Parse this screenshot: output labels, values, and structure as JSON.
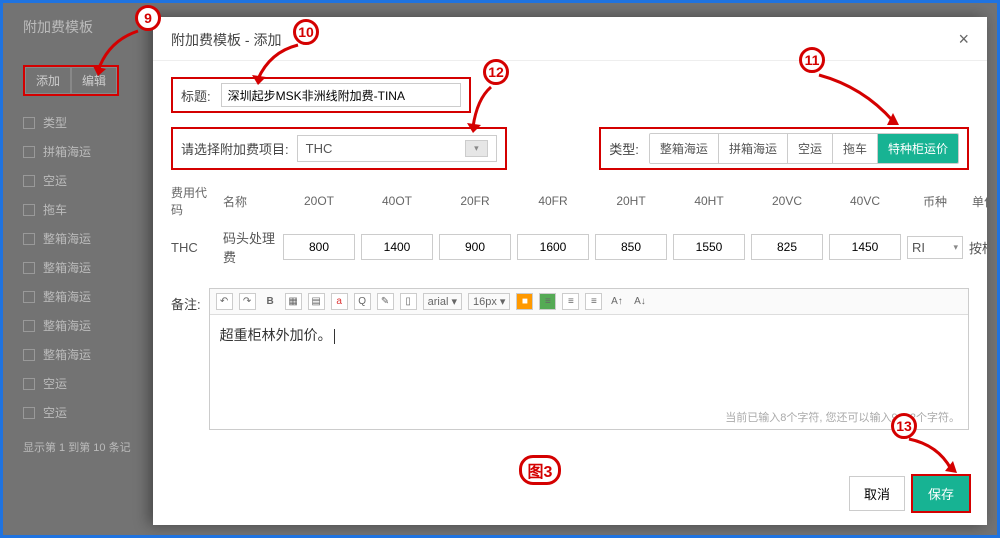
{
  "sidebar": {
    "title": "附加费模板",
    "add_label": "添加",
    "edit_label": "编辑",
    "items": [
      {
        "label": "类型"
      },
      {
        "label": "拼箱海运"
      },
      {
        "label": "空运"
      },
      {
        "label": "拖车"
      },
      {
        "label": "整箱海运"
      },
      {
        "label": "整箱海运"
      },
      {
        "label": "整箱海运"
      },
      {
        "label": "整箱海运"
      },
      {
        "label": "整箱海运"
      },
      {
        "label": "空运"
      },
      {
        "label": "空运"
      }
    ],
    "status": "显示第 1 到第 10 条记"
  },
  "modal": {
    "title": "附加费模板 - 添加",
    "close": "×",
    "title_label": "标题:",
    "title_value": "深圳起步MSK非洲线附加费-TINA",
    "select_label": "请选择附加费项目:",
    "select_value": "THC",
    "type_label": "类型:",
    "types": [
      "整箱海运",
      "拼箱海运",
      "空运",
      "拖车",
      "特种柜运价"
    ],
    "type_active_index": 4,
    "headers": [
      "费用代码",
      "名称",
      "20OT",
      "40OT",
      "20FR",
      "40FR",
      "20HT",
      "40HT",
      "20VC",
      "40VC",
      "币种",
      "单位",
      ""
    ],
    "row": {
      "code": "THC",
      "name": "码头处理费",
      "v": [
        "800",
        "1400",
        "900",
        "1600",
        "850",
        "1550",
        "825",
        "1450"
      ],
      "currency": "RI",
      "unit": "按柜"
    },
    "remark_label": "备注:",
    "remark_value": "超重柜林外加价。",
    "editor": {
      "font_family": "arial",
      "font_size": "16px",
      "counter": "当前已输入8个字符, 您还可以输入9992个字符。"
    },
    "btn_cancel": "取消",
    "btn_save": "保存"
  },
  "annotations": {
    "a9": "9",
    "a10": "10",
    "a11": "11",
    "a12": "12",
    "a13": "13",
    "fig": "图3"
  }
}
